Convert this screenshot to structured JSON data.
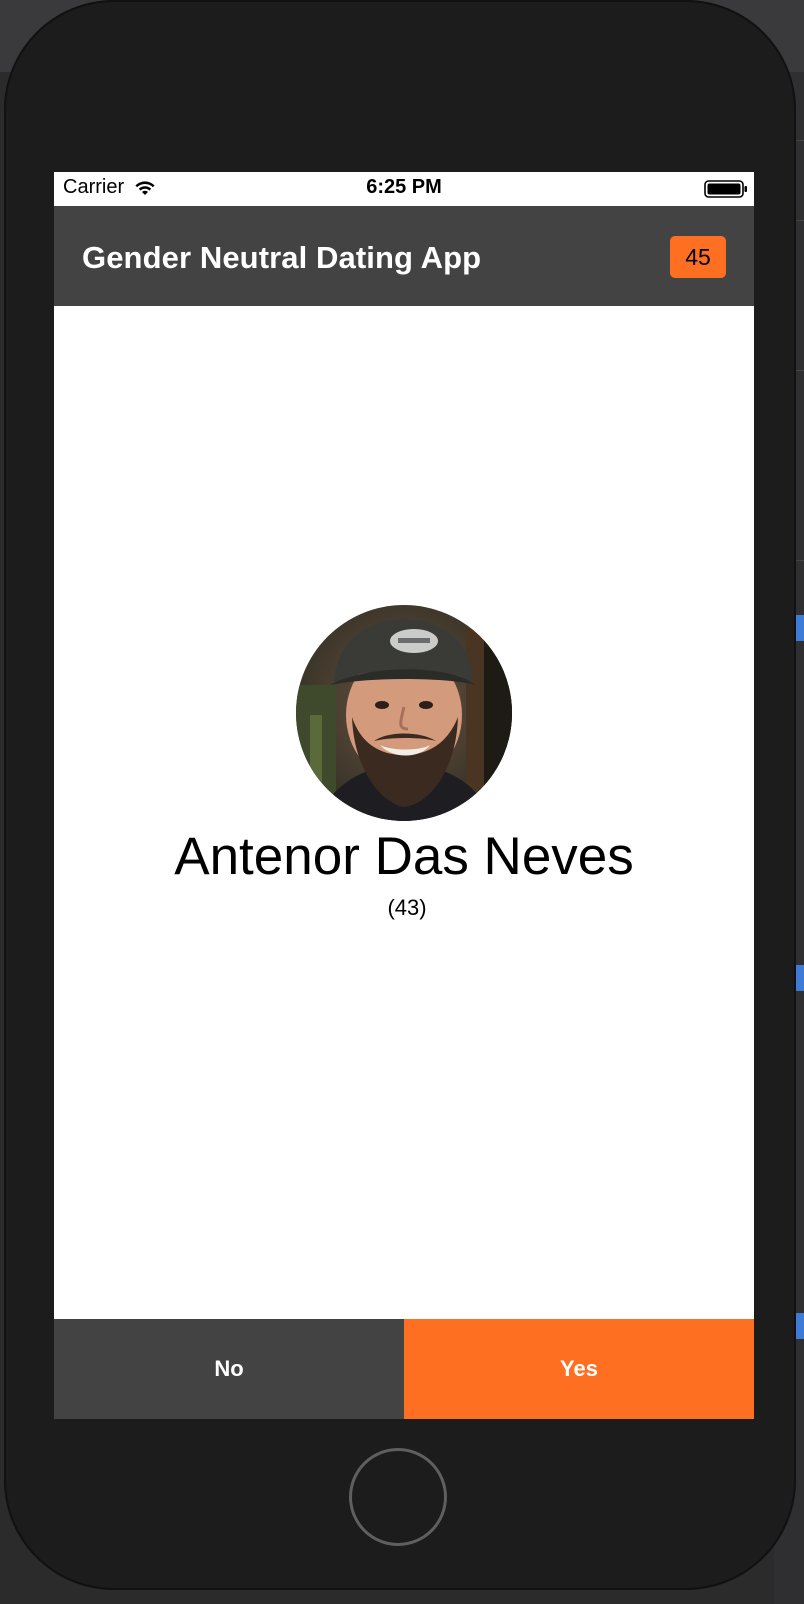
{
  "status_bar": {
    "carrier": "Carrier",
    "time": "6:25 PM",
    "wifi_icon": "wifi-icon",
    "battery_icon": "battery-icon"
  },
  "header": {
    "title": "Gender Neutral Dating App",
    "count": "45"
  },
  "profile": {
    "name": "Antenor Das Neves",
    "age": "(43)",
    "avatar": "profile-photo"
  },
  "actions": {
    "no_label": "No",
    "yes_label": "Yes"
  },
  "colors": {
    "accent": "#fe6f22",
    "bar": "#434343",
    "background": "#ffffff"
  }
}
